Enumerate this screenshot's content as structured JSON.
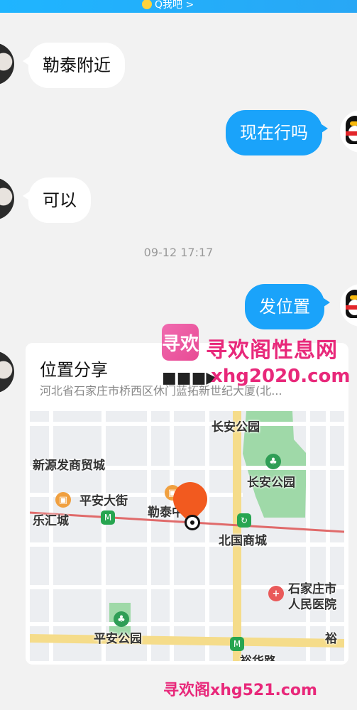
{
  "header": {
    "link_text": "Q我吧 >"
  },
  "messages": [
    {
      "side": "left",
      "text": "勒泰附近"
    },
    {
      "side": "right",
      "text": "现在行吗"
    },
    {
      "side": "left",
      "text": "可以"
    },
    {
      "side": "right",
      "text": "发位置"
    }
  ],
  "timestamp": "09-12 17:17",
  "location_card": {
    "title": "位置分享",
    "address": "河北省石家庄市桥西区休门蓝拓新世纪大厦(北..."
  },
  "map": {
    "labels": {
      "changan_park_top": "长安公园",
      "xinyuanfa": "新源发商贸城",
      "pingan_street": "平安大街",
      "changan_park": "长安公园",
      "lehui": "乐汇城",
      "letai": "勒泰中心",
      "beiguo": "北国商城",
      "hospital_1": "石家庄市",
      "hospital_2": "人民医院",
      "pingan_park": "平安公园",
      "yu": "裕",
      "yuhua_road": "裕华路"
    },
    "colors": {
      "road_yellow": "#f5dc8a",
      "park_green": "#9fd9a8",
      "metro_line": "#e06a6a",
      "pin": "#f25a1f"
    }
  },
  "watermark": {
    "logo": "寻欢",
    "title": "寻欢阁性息网",
    "arrow": "■■■▶",
    "url": "xhg2020.com",
    "bottom": "寻欢阁xhg521.com"
  }
}
